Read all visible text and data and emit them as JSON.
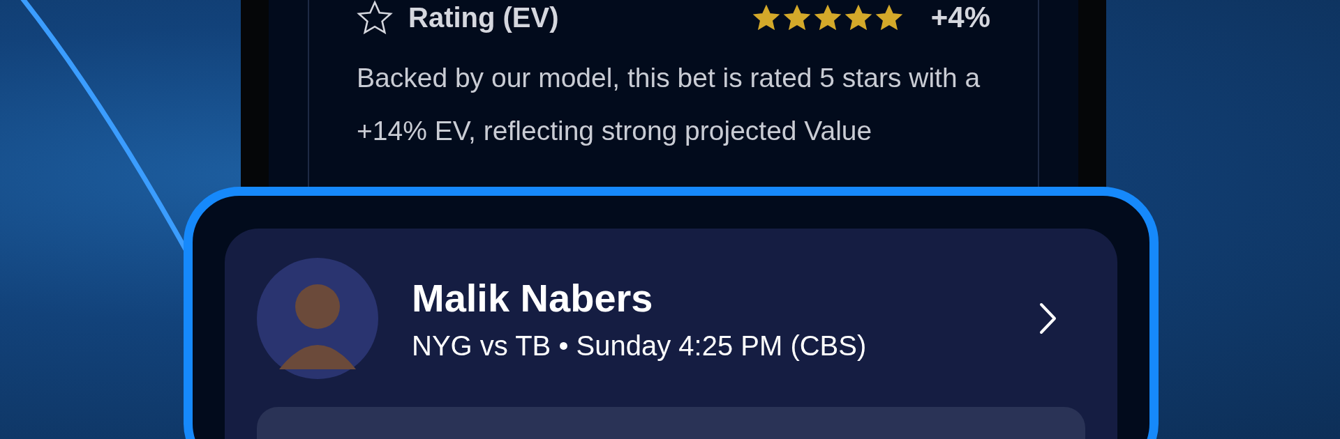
{
  "rating": {
    "label": "Rating (EV)",
    "stars": 5,
    "value": "+4%"
  },
  "description": "Backed by our model, this bet is rated 5 stars with a +14% EV, reflecting strong projected Value",
  "player": {
    "name": "Malik Nabers",
    "matchup": "NYG vs TB • Sunday 4:25 PM (CBS)"
  }
}
